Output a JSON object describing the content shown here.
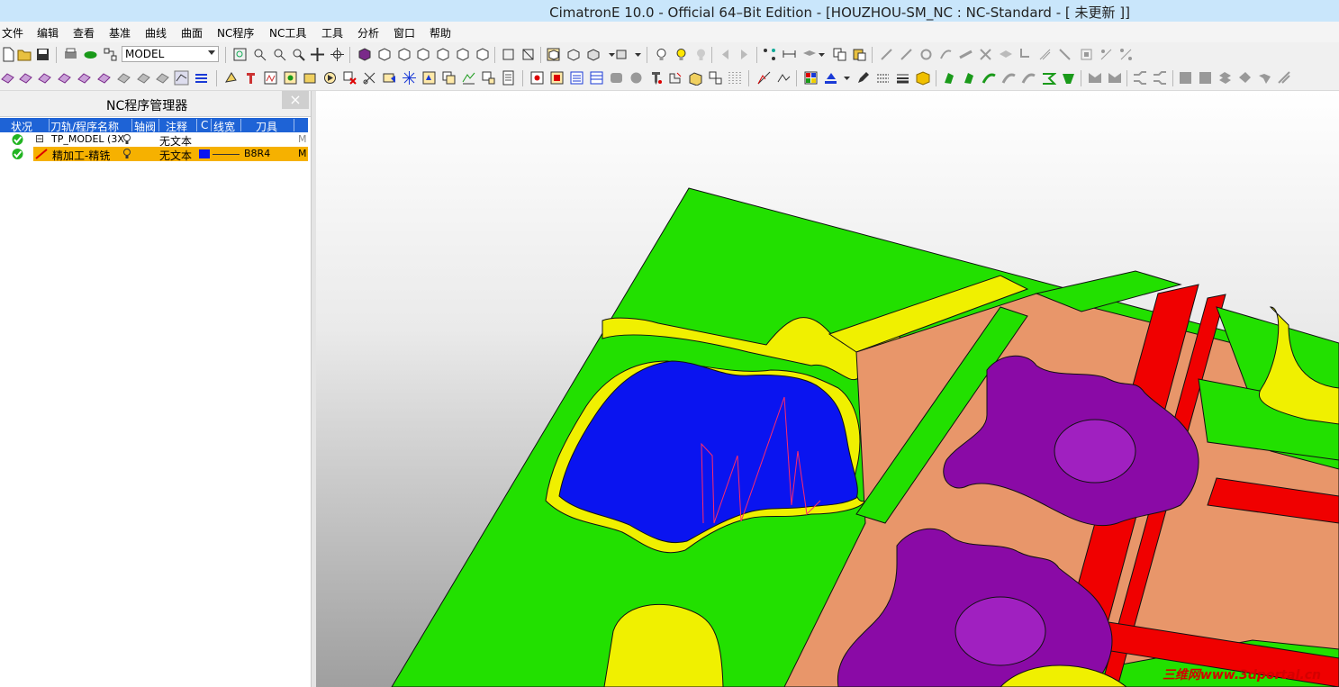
{
  "window": {
    "title": "CimatronE 10.0 - Official 64–Bit Edition - [HOUZHOU-SM_NC : NC-Standard - [ 未更新 ]]"
  },
  "menu": [
    "文件",
    "编辑",
    "查看",
    "基准",
    "曲线",
    "曲面",
    "NC程序",
    "NC工具",
    "工具",
    "分析",
    "窗口",
    "帮助"
  ],
  "toolbar": {
    "model_combo": "MODEL"
  },
  "nc_manager": {
    "title": "NC程序管理器",
    "close_glyph": "×",
    "columns": [
      "状况",
      "刀轨/程序名称",
      "轴阀",
      "注释",
      "C",
      "线宽",
      "刀具"
    ],
    "rows": [
      {
        "name": "TP_MODEL (3X",
        "comment": "无文本",
        "tool": "",
        "mark": "M",
        "expander": "⊟"
      },
      {
        "name": "精加工-精铣",
        "comment": "无文本",
        "tool": "B8R4",
        "mark": "M"
      }
    ]
  },
  "viewport": {
    "watermark": "三维网www.3dportal.cn"
  },
  "colors": {
    "green": "#22e000",
    "yellow": "#f0f000",
    "red": "#f00000",
    "orange": "#e8966a",
    "purple": "#8a0aa6",
    "blue": "#0a14f0",
    "column_header": "#1e63d6",
    "selected_row": "#f6b100"
  }
}
